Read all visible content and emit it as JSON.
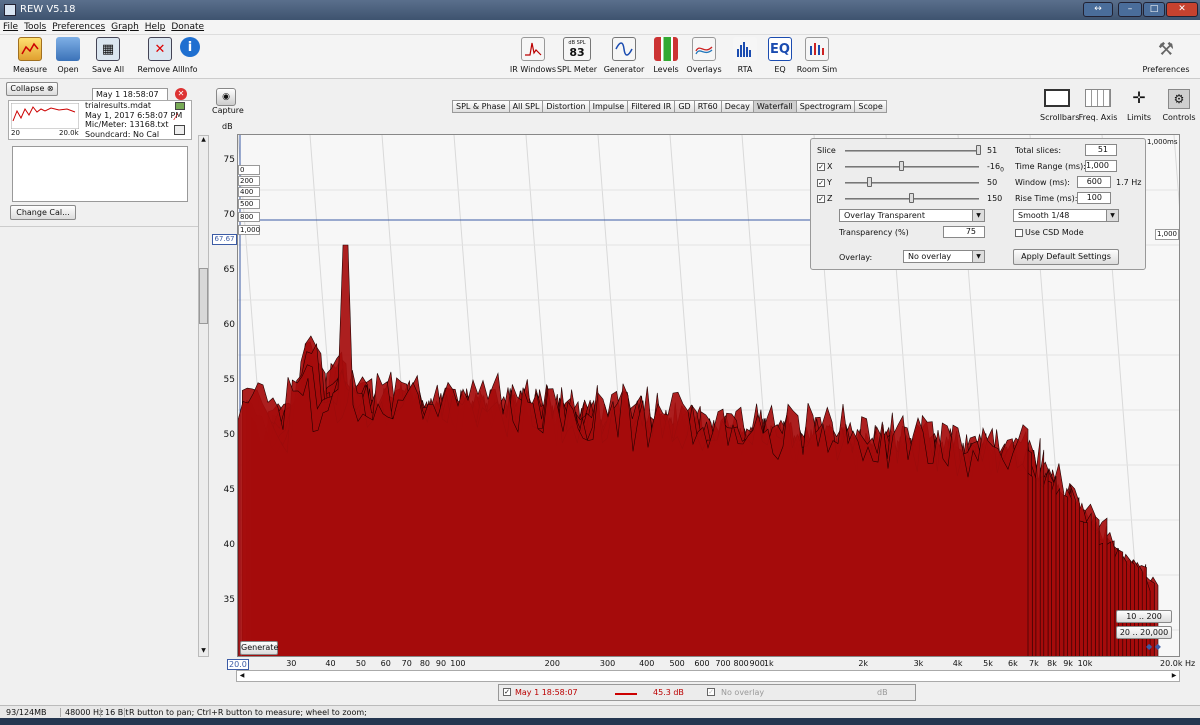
{
  "window": {
    "title": "REW V5.18"
  },
  "menu": [
    "File",
    "Tools",
    "Preferences",
    "Graph",
    "Help",
    "Donate"
  ],
  "toolbar_left": [
    {
      "label": "Measure",
      "icon": "measure-icon"
    },
    {
      "label": "Open",
      "icon": "folder-icon"
    },
    {
      "label": "Save All",
      "icon": "save-icon"
    },
    {
      "label": "Remove All",
      "icon": "remove-icon"
    },
    {
      "label": "Info",
      "icon": "info-icon"
    }
  ],
  "toolbar_center": [
    {
      "label": "IR Windows",
      "icon": "ir-windows-icon"
    },
    {
      "label": "SPL Meter",
      "icon": "spl-meter-icon",
      "top": "dB SPL",
      "value": "83"
    },
    {
      "label": "Generator",
      "icon": "generator-icon"
    },
    {
      "label": "Levels",
      "icon": "levels-icon"
    },
    {
      "label": "Overlays",
      "icon": "overlays-icon"
    },
    {
      "label": "RTA",
      "icon": "rta-icon"
    },
    {
      "label": "EQ",
      "icon": "eq-icon"
    },
    {
      "label": "Room Sim",
      "icon": "room-sim-icon"
    }
  ],
  "toolbar_right": {
    "label": "Preferences",
    "icon": "preferences-icon"
  },
  "left": {
    "collapse": "Collapse",
    "measurement": {
      "name": "May 1 18:58:07",
      "file": "trialresults.mdat",
      "date": "May 1, 2017 6:58:07 PM",
      "mic": "Mic/Meter: 13168.txt",
      "soundcard": "Soundcard: No Cal",
      "thumb_left": "20",
      "thumb_right": "20.0k"
    },
    "change_cal": "Change Cal..."
  },
  "capture": {
    "label": "Capture",
    "unit": "dB"
  },
  "tabs": [
    "SPL & Phase",
    "All SPL",
    "Distortion",
    "Impulse",
    "Filtered IR",
    "GD",
    "RT60",
    "Decay",
    "Waterfall",
    "Spectrogram",
    "Scope"
  ],
  "selected_tab": "Waterfall",
  "graph_tools": [
    {
      "label": "Scrollbars",
      "icon": "scrollbars-icon"
    },
    {
      "label": "Freq. Axis",
      "icon": "freq-axis-icon"
    },
    {
      "label": "Limits",
      "icon": "limits-icon"
    },
    {
      "label": "Controls",
      "icon": "controls-icon"
    }
  ],
  "controls": {
    "slice_label": "Slice",
    "slice_value": "51",
    "x_label": "X",
    "x_value": "-16",
    "x_sub": "0",
    "y_label": "Y",
    "y_value": "50",
    "z_label": "Z",
    "z_value": "150",
    "total_slices_label": "Total slices:",
    "total_slices": "51",
    "time_range_label": "Time Range (ms):",
    "time_range": "1,000",
    "window_label": "Window (ms):",
    "window": "600",
    "window_hz": "1.7 Hz",
    "rise_time_label": "Rise Time (ms):",
    "rise_time": "100",
    "mode": "Overlay Transparent",
    "smoothing": "Smooth 1/48",
    "transparency_label": "Transparency (%)",
    "transparency": "75",
    "csd_label": "Use CSD Mode",
    "overlay_label": "Overlay:",
    "overlay": "No overlay",
    "apply_defaults": "Apply Default Settings"
  },
  "graph": {
    "y_ticks": [
      "75",
      "70",
      "65",
      "60",
      "55",
      "50",
      "45",
      "40",
      "35"
    ],
    "y_value_marker": "67.67",
    "time_labels": [
      "0",
      "200",
      "400",
      "500",
      "800",
      "1,000"
    ],
    "right_labels": {
      "time": "1,000ms",
      "t1000": "1,000",
      "t800": "800",
      "t400": "400"
    },
    "x_ticks": [
      "20.0",
      "30",
      "40",
      "50",
      "60",
      "70",
      "80",
      "90",
      "100",
      "200",
      "300",
      "400",
      "500",
      "600",
      "700",
      "800",
      "900",
      "1k",
      "2k",
      "3k",
      "4k",
      "5k",
      "6k",
      "7k",
      "8k",
      "9k",
      "10k",
      "20.0k Hz"
    ],
    "generate": "Generate",
    "range_buttons": [
      "10 .. 200",
      "20 .. 20,000"
    ]
  },
  "legend": {
    "name": "May 1 18:58:07",
    "value": "45.3 dB",
    "overlay": "No overlay",
    "unit": "dB"
  },
  "status": {
    "memory": "93/124MB",
    "rate": "48000 Hz",
    "bits": "16 Bit",
    "hint": "R button to pan; Ctrl+R button to measure; wheel to zoom;"
  },
  "colors": {
    "waterfall": "#a50c0c",
    "accent": "#3b5ba5"
  }
}
